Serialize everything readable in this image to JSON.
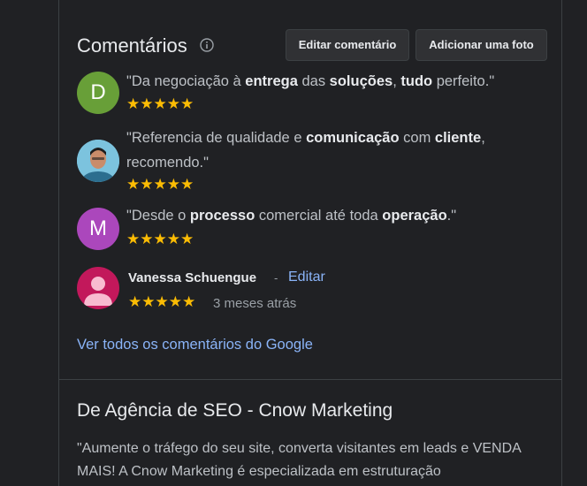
{
  "reviews_section": {
    "title": "Comentários",
    "info_icon": "info-icon",
    "edit_button_label": "Editar comentário",
    "add_photo_button_label": "Adicionar uma foto",
    "reviews": [
      {
        "avatar_letter": "D",
        "avatar_color": "#689f38",
        "parts": [
          "\"Da negociação à ",
          "entrega",
          " das ",
          "soluções",
          ", ",
          "tudo",
          " perfeito.\""
        ],
        "stars": "★★★★★"
      },
      {
        "avatar_icon": "profile-photo-avatar",
        "avatar_color": "#6fb6d6",
        "parts": [
          "\"Referencia de qualidade e ",
          "comunicação",
          " com ",
          "cliente",
          ", recomendo.\""
        ],
        "stars": "★★★★★"
      },
      {
        "avatar_letter": "M",
        "avatar_color": "#ab47bc",
        "parts": [
          "\"Desde o ",
          "processo",
          " comercial até toda ",
          "operação",
          ".\""
        ],
        "stars": "★★★★★"
      }
    ],
    "user_review": {
      "name": "Vanessa Schuengue",
      "separator": "-",
      "edit_link": "Editar",
      "stars": "★★★★★",
      "time": "3 meses atrás",
      "avatar_icon": "person-silhouette-icon",
      "avatar_color": "#c2185b"
    },
    "all_reviews_link": "Ver todos os comentários do Google"
  },
  "description": {
    "title": "De Agência de SEO - Cnow Marketing",
    "text": "\"Aumente o tráfego do seu site, converta visitantes em leads e VENDA MAIS! A Cnow Marketing é especializada em estruturação"
  },
  "colors": {
    "background": "#202124",
    "text_primary": "#e8eaed",
    "text_secondary": "#bdc1c6",
    "link": "#8ab4f8",
    "star": "#fbbc04"
  }
}
